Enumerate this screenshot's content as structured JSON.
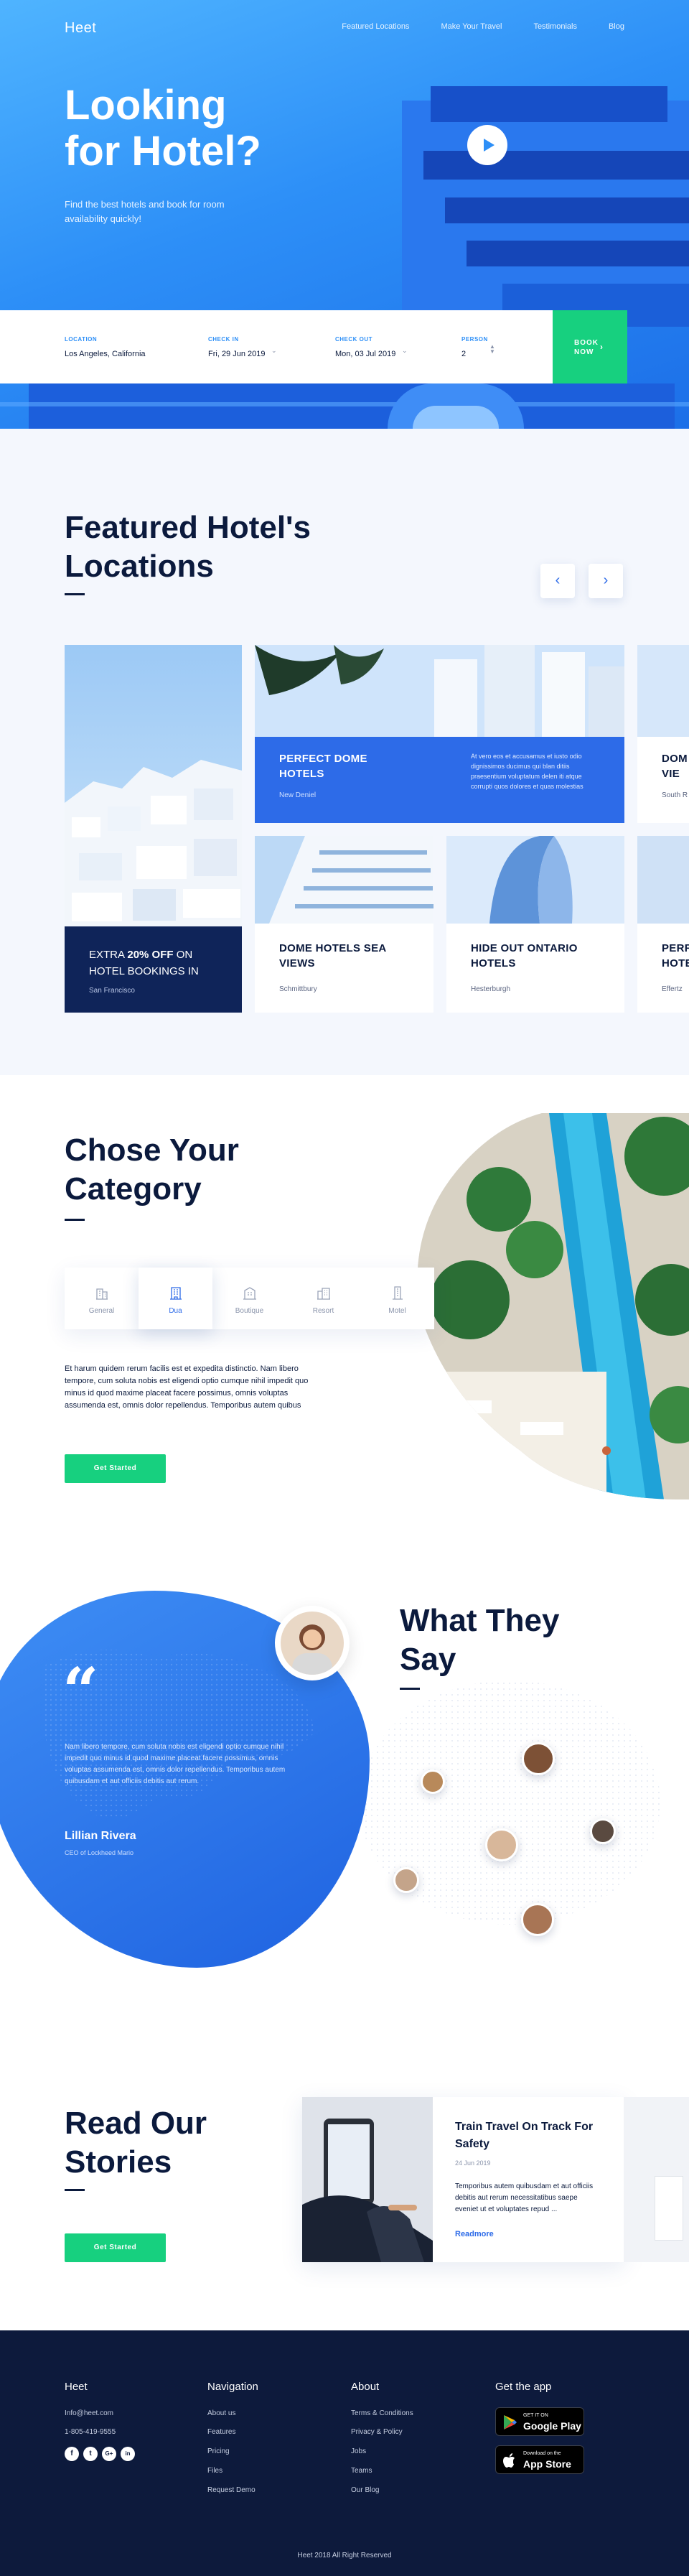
{
  "brand": "Heet",
  "nav": [
    "Featured Locations",
    "Make Your Travel",
    "Testimonials",
    "Blog"
  ],
  "hero": {
    "title_line1": "Looking",
    "title_line2": "for Hotel?",
    "subtitle": "Find the best hotels and book for room availability quickly!"
  },
  "search": {
    "location_label": "LOCATION",
    "location_value": "Los Angeles, California",
    "checkin_label": "CHECK IN",
    "checkin_value": "Fri, 29 Jun 2019",
    "checkout_label": "CHECK OUT",
    "checkout_value": "Mon, 03 Jul 2019",
    "person_label": "PERSON",
    "person_value": "2",
    "book_line1": "BOOK",
    "book_line2": "NOW"
  },
  "featured": {
    "title_line1": "Featured Hotel's",
    "title_line2": "Locations",
    "promo_pre": "EXTRA ",
    "promo_bold": "20% OFF",
    "promo_post": " ON HOTEL BOOKINGS IN",
    "promo_location": "San Francisco",
    "highlight_title": "PERFECT DOME HOTELS",
    "highlight_location": "New Deniel",
    "highlight_desc": "At vero eos et accusamus et iusto odio dignissimos ducimus qui blan ditiis praesentium voluptatum delen iti atque corrupti quos dolores et quas molestias",
    "cards": [
      {
        "title": "DOME HOTELS SEA VIEWS",
        "location": "Schmittbury"
      },
      {
        "title": "HIDE OUT ONTARIO HOTELS",
        "location": "Hesterburgh"
      }
    ],
    "peek_top_title": "DOM",
    "peek_top_sub": "VIE",
    "peek_top_loc": "South R",
    "peek_bottom_title": "PERF",
    "peek_bottom_title2": "HOTE",
    "peek_bottom_loc": "Effertz"
  },
  "category": {
    "title_line1": "Chose Your",
    "title_line2": "Category",
    "tabs": [
      "General",
      "Dua",
      "Boutique",
      "Resort",
      "Motel"
    ],
    "active_tab": "Dua",
    "text": "Et harum quidem rerum facilis est et expedita distinctio. Nam libero tempore, cum soluta nobis est eligendi optio cumque nihil impedit quo minus id quod maxime placeat facere possimus, omnis voluptas assumenda est, omnis dolor repellendus. Temporibus autem quibus",
    "button": "Get Started"
  },
  "testimonial": {
    "title_line1": "What They",
    "title_line2": "Say",
    "quote": "Nam libero tempore, cum soluta nobis est eligendi optio cumque nihil impedit quo minus id quod maxime placeat facere possimus, omnis voluptas assumenda est, omnis dolor repellendus. Temporibus autem quibusdam et aut officiis debitis aut rerum.",
    "name": "Lillian Rivera",
    "role": "CEO of Lockheed Mario"
  },
  "stories": {
    "title_line1": "Read Our",
    "title_line2": "Stories",
    "button": "Get Started",
    "post_title": "Train Travel On Track For Safety",
    "post_date": "24 Jun 2019",
    "post_text": "Temporibus autem quibusdam et aut officiis debitis aut rerum necessitatibus saepe eveniet ut et voluptates repud ...",
    "post_more": "Readmore"
  },
  "footer": {
    "col1_title": "Heet",
    "email": "Info@heet.com",
    "phone": "1-805-419-9555",
    "social": [
      "f",
      "t",
      "G+",
      "in"
    ],
    "col2_title": "Navigation",
    "col2_links": [
      "About us",
      "Features",
      "Pricing",
      "Files",
      "Request Demo"
    ],
    "col3_title": "About",
    "col3_links": [
      "Terms & Conditions",
      "Privacy & Policy",
      "Jobs",
      "Teams",
      "Our Blog"
    ],
    "col4_title": "Get the app",
    "gp_small": "GET IT ON",
    "gp_big": "Google Play",
    "as_small": "Download on the",
    "as_big": "App Store",
    "copyright": "Heet 2018 All Right Reserved"
  },
  "colors": {
    "primary": "#2d6be8",
    "accent": "#17d07f",
    "dark": "#0d1a3c"
  }
}
